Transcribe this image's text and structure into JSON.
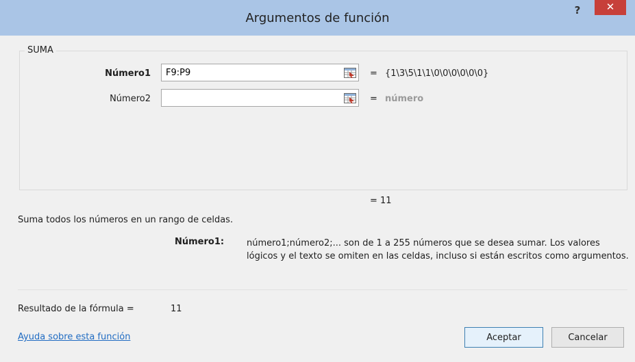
{
  "window": {
    "title": "Argumentos de función",
    "help_label": "?",
    "close_label": "✕"
  },
  "function": {
    "name": "SUMA",
    "result_preview": "= 11",
    "description": "Suma todos los números en un rango de celdas."
  },
  "arguments": [
    {
      "label": "Número1",
      "value": "F9:P9",
      "placeholder": "",
      "equals": "=",
      "evaluated": "{1\\3\\5\\1\\1\\0\\0\\0\\0\\0\\0}"
    },
    {
      "label": "Número2",
      "value": "",
      "placeholder": "",
      "equals": "=",
      "evaluated": "número"
    }
  ],
  "argument_help": {
    "name": "Número1:",
    "text": "número1;número2;... son de 1 a 255 números que se desea sumar. Los valores lógicos y el texto se omiten en las celdas, incluso si están escritos como argumentos."
  },
  "formula_result": {
    "label": "Resultado de la fórmula =",
    "value": "11"
  },
  "footer": {
    "help_link": "Ayuda sobre esta función",
    "ok_label": "Aceptar",
    "cancel_label": "Cancelar"
  },
  "icons": {
    "range_selector": "collapse-range-icon"
  },
  "colors": {
    "titlebar": "#aac5e6",
    "close_button": "#c7403a",
    "link": "#1f6bc2",
    "hint_text": "#9a9a9a"
  }
}
